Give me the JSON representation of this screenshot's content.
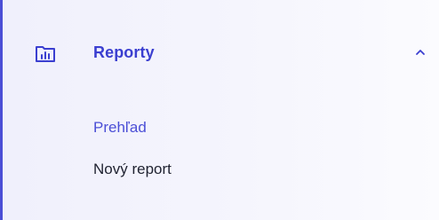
{
  "section": {
    "label": "Reporty",
    "icon": "bar-chart-folder-icon",
    "expanded": true,
    "toggle_icon": "chevron-up-icon"
  },
  "submenu": {
    "items": [
      {
        "label": "Prehľad",
        "active": true
      },
      {
        "label": "Nový report",
        "active": false
      }
    ]
  },
  "colors": {
    "accent": "#4b4fd6",
    "text": "#1f2230",
    "background": "#f3f3fc"
  }
}
